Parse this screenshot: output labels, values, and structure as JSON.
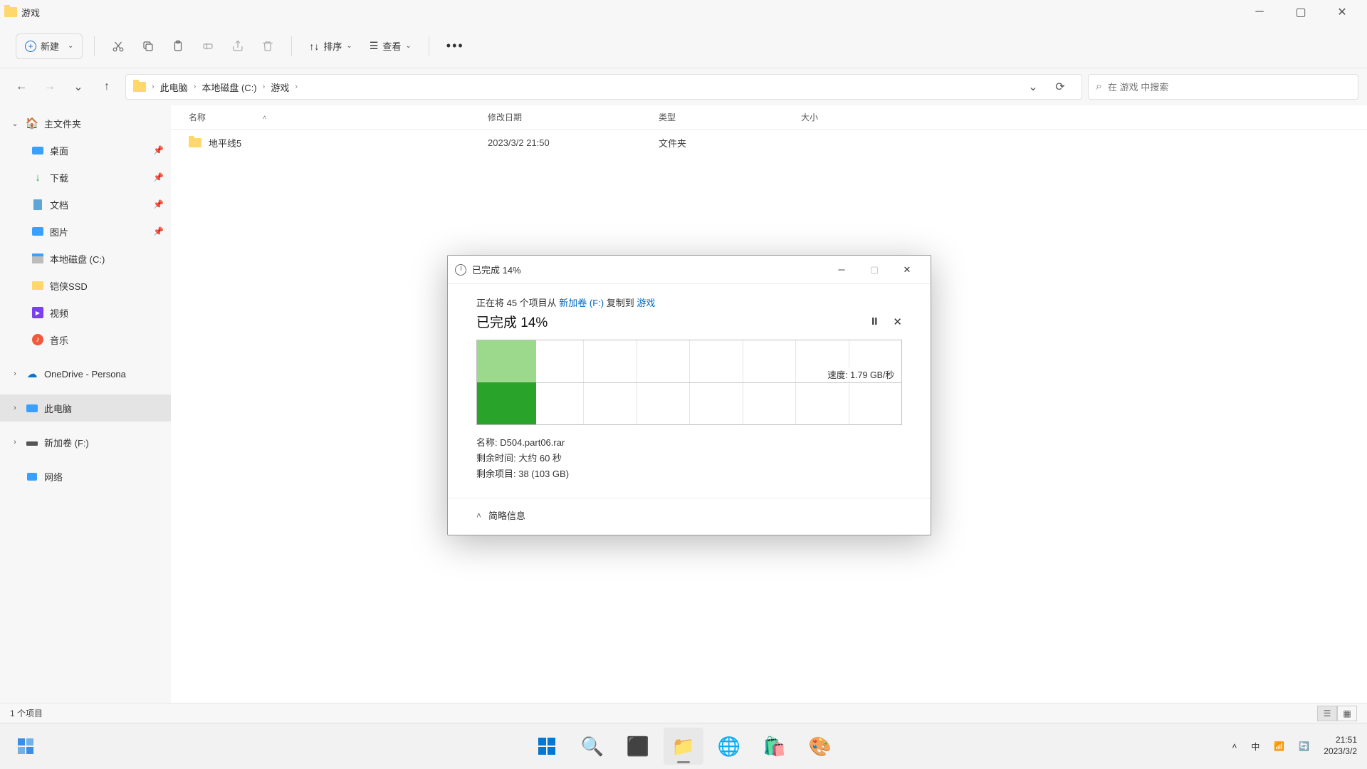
{
  "window": {
    "title": "游戏"
  },
  "toolbar": {
    "new": "新建",
    "sort": "排序",
    "view": "查看"
  },
  "breadcrumb": {
    "parts": [
      "此电脑",
      "本地磁盘 (C:)",
      "游戏"
    ]
  },
  "search": {
    "placeholder": "在 游戏 中搜索"
  },
  "sidebar": {
    "home": "主文件夹",
    "desktop": "桌面",
    "downloads": "下载",
    "documents": "文档",
    "pictures": "图片",
    "localdisk": "本地磁盘 (C:)",
    "kx": "铠侠SSD",
    "video": "视频",
    "music": "音乐",
    "onedrive": "OneDrive - Persona",
    "thispc": "此电脑",
    "newvol": "新加卷 (F:)",
    "network": "网络"
  },
  "columns": {
    "name": "名称",
    "date": "修改日期",
    "type": "类型",
    "size": "大小"
  },
  "rows": [
    {
      "name": "地平线5",
      "date": "2023/3/2 21:50",
      "type": "文件夹",
      "size": ""
    }
  ],
  "status": {
    "count": "1 个项目"
  },
  "copy": {
    "title": "已完成 14%",
    "line_prefix": "正在将 45 个项目从 ",
    "src": "新加卷 (F:)",
    "line_mid": " 复制到 ",
    "dst": "游戏",
    "progress": "已完成 14%",
    "speed_label": "速度: ",
    "speed_value": "1.79 GB/秒",
    "name_label": "名称: ",
    "name_value": "D504.part06.rar",
    "time_label": "剩余时间: ",
    "time_value": "大约 60 秒",
    "items_label": "剩余项目: ",
    "items_value": "38 (103 GB)",
    "expand": "简略信息"
  },
  "taskbar": {
    "ime": "中",
    "time": "21:51",
    "date": "2023/3/2"
  }
}
